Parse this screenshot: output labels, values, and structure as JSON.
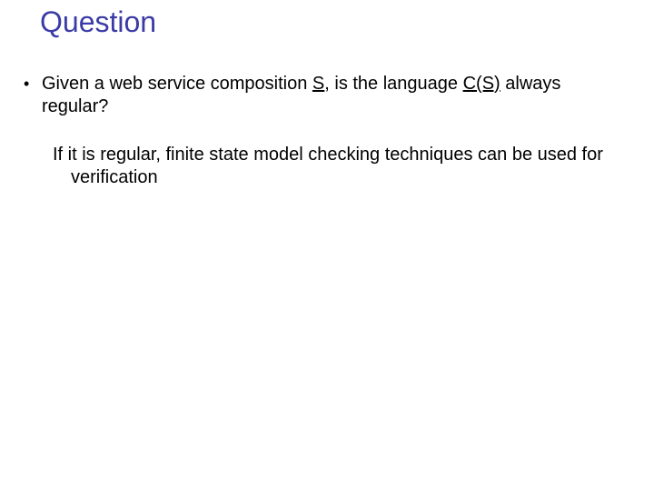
{
  "title": "Question",
  "bullet1": {
    "pre": "Given a web service composition ",
    "s": "S",
    "mid": ", is the language ",
    "cs": "C(S)",
    "post": " always regular?"
  },
  "sub1": "If it is regular, finite state model checking techniques can be used for verification",
  "glyphs": {
    "bullet": "•"
  }
}
